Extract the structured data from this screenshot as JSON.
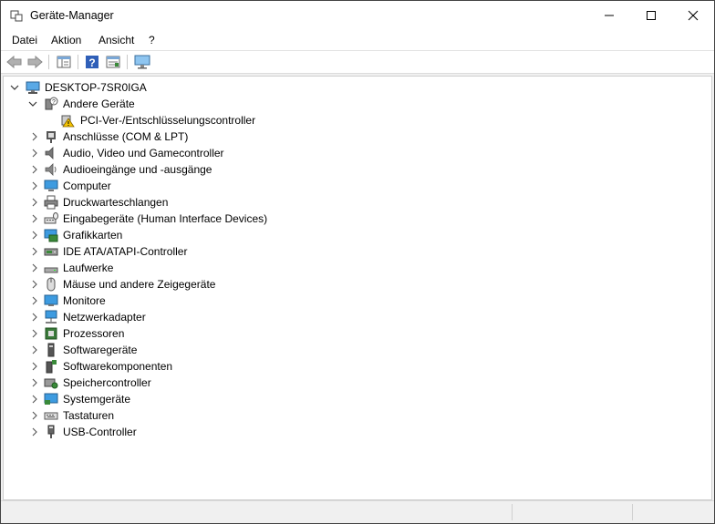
{
  "window": {
    "title": "Geräte-Manager"
  },
  "menu": {
    "items": [
      "Datei",
      "Aktion",
      "Ansicht",
      "?"
    ]
  },
  "tree": {
    "root": "DESKTOP-7SR0IGA",
    "other": "Andere Geräte",
    "child": "PCI-Ver-/Entschlüsselungscontroller",
    "categories": [
      "Anschlüsse (COM & LPT)",
      "Audio, Video und Gamecontroller",
      "Audioeingänge und -ausgänge",
      "Computer",
      "Druckwarteschlangen",
      "Eingabegeräte (Human Interface Devices)",
      "Grafikkarten",
      "IDE ATA/ATAPI-Controller",
      "Laufwerke",
      "Mäuse und andere Zeigegeräte",
      "Monitore",
      "Netzwerkadapter",
      "Prozessoren",
      "Softwaregeräte",
      "Softwarekomponenten",
      "Speichercontroller",
      "Systemgeräte",
      "Tastaturen",
      "USB-Controller"
    ]
  }
}
